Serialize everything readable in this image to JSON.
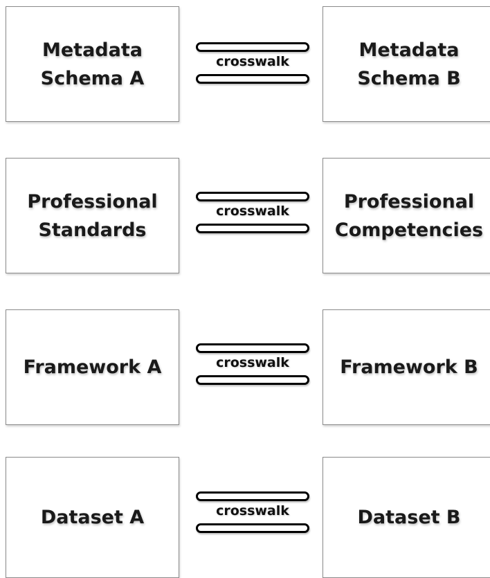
{
  "rows": [
    {
      "left": {
        "line1": "Metadata",
        "line2": "Schema A"
      },
      "connector": "crosswalk",
      "right": {
        "line1": "Metadata",
        "line2": "Schema B"
      }
    },
    {
      "left": {
        "line1": "Professional",
        "line2": "Standards"
      },
      "connector": "crosswalk",
      "right": {
        "line1": "Professional",
        "line2": "Competencies"
      }
    },
    {
      "left": {
        "line1": "Framework A"
      },
      "connector": "crosswalk",
      "right": {
        "line1": "Framework B"
      }
    },
    {
      "left": {
        "line1": "Dataset A"
      },
      "connector": "crosswalk",
      "right": {
        "line1": "Dataset B"
      }
    }
  ]
}
